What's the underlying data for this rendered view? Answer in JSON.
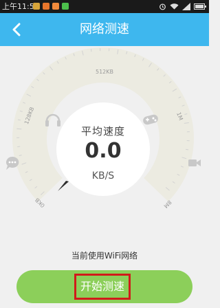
{
  "status_bar": {
    "time": "上午11:57",
    "notif_colors": [
      "#d6a43a",
      "#e8762c",
      "#f08a3c",
      "#4cbf4c"
    ]
  },
  "header": {
    "back_icon": "chevron-left-icon",
    "title": "网络测速"
  },
  "gauge": {
    "tick_labels": [
      "0KB",
      "128KB",
      "512KB",
      "1M",
      "8M"
    ],
    "mode_icons": [
      "chat-icon",
      "headphones-icon",
      "gamepad-icon",
      "video-camera-icon"
    ],
    "speed_caption": "平均速度",
    "speed_value": "0.0",
    "speed_unit": "KB/S",
    "level": 0
  },
  "network_status": "当前使用WiFi网络",
  "start_button": {
    "label": "开始测速"
  },
  "colors": {
    "accent": "#3eb7ee",
    "button": "#8ccf5a",
    "highlight": "#d11a1a",
    "gauge_fill": "#ecebe1"
  }
}
